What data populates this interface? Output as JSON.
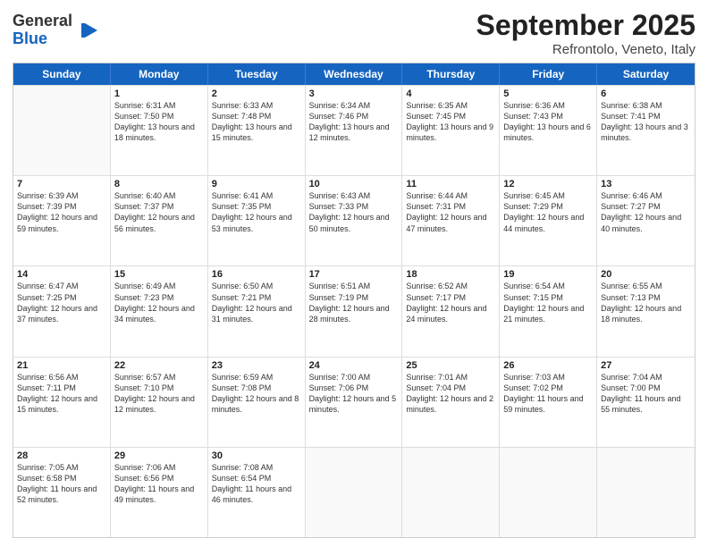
{
  "logo": {
    "general": "General",
    "blue": "Blue"
  },
  "title": {
    "month": "September 2025",
    "location": "Refrontolo, Veneto, Italy"
  },
  "header_days": [
    "Sunday",
    "Monday",
    "Tuesday",
    "Wednesday",
    "Thursday",
    "Friday",
    "Saturday"
  ],
  "weeks": [
    [
      {
        "date": "",
        "sunrise": "",
        "sunset": "",
        "daylight": ""
      },
      {
        "date": "1",
        "sunrise": "Sunrise: 6:31 AM",
        "sunset": "Sunset: 7:50 PM",
        "daylight": "Daylight: 13 hours and 18 minutes."
      },
      {
        "date": "2",
        "sunrise": "Sunrise: 6:33 AM",
        "sunset": "Sunset: 7:48 PM",
        "daylight": "Daylight: 13 hours and 15 minutes."
      },
      {
        "date": "3",
        "sunrise": "Sunrise: 6:34 AM",
        "sunset": "Sunset: 7:46 PM",
        "daylight": "Daylight: 13 hours and 12 minutes."
      },
      {
        "date": "4",
        "sunrise": "Sunrise: 6:35 AM",
        "sunset": "Sunset: 7:45 PM",
        "daylight": "Daylight: 13 hours and 9 minutes."
      },
      {
        "date": "5",
        "sunrise": "Sunrise: 6:36 AM",
        "sunset": "Sunset: 7:43 PM",
        "daylight": "Daylight: 13 hours and 6 minutes."
      },
      {
        "date": "6",
        "sunrise": "Sunrise: 6:38 AM",
        "sunset": "Sunset: 7:41 PM",
        "daylight": "Daylight: 13 hours and 3 minutes."
      }
    ],
    [
      {
        "date": "7",
        "sunrise": "Sunrise: 6:39 AM",
        "sunset": "Sunset: 7:39 PM",
        "daylight": "Daylight: 12 hours and 59 minutes."
      },
      {
        "date": "8",
        "sunrise": "Sunrise: 6:40 AM",
        "sunset": "Sunset: 7:37 PM",
        "daylight": "Daylight: 12 hours and 56 minutes."
      },
      {
        "date": "9",
        "sunrise": "Sunrise: 6:41 AM",
        "sunset": "Sunset: 7:35 PM",
        "daylight": "Daylight: 12 hours and 53 minutes."
      },
      {
        "date": "10",
        "sunrise": "Sunrise: 6:43 AM",
        "sunset": "Sunset: 7:33 PM",
        "daylight": "Daylight: 12 hours and 50 minutes."
      },
      {
        "date": "11",
        "sunrise": "Sunrise: 6:44 AM",
        "sunset": "Sunset: 7:31 PM",
        "daylight": "Daylight: 12 hours and 47 minutes."
      },
      {
        "date": "12",
        "sunrise": "Sunrise: 6:45 AM",
        "sunset": "Sunset: 7:29 PM",
        "daylight": "Daylight: 12 hours and 44 minutes."
      },
      {
        "date": "13",
        "sunrise": "Sunrise: 6:46 AM",
        "sunset": "Sunset: 7:27 PM",
        "daylight": "Daylight: 12 hours and 40 minutes."
      }
    ],
    [
      {
        "date": "14",
        "sunrise": "Sunrise: 6:47 AM",
        "sunset": "Sunset: 7:25 PM",
        "daylight": "Daylight: 12 hours and 37 minutes."
      },
      {
        "date": "15",
        "sunrise": "Sunrise: 6:49 AM",
        "sunset": "Sunset: 7:23 PM",
        "daylight": "Daylight: 12 hours and 34 minutes."
      },
      {
        "date": "16",
        "sunrise": "Sunrise: 6:50 AM",
        "sunset": "Sunset: 7:21 PM",
        "daylight": "Daylight: 12 hours and 31 minutes."
      },
      {
        "date": "17",
        "sunrise": "Sunrise: 6:51 AM",
        "sunset": "Sunset: 7:19 PM",
        "daylight": "Daylight: 12 hours and 28 minutes."
      },
      {
        "date": "18",
        "sunrise": "Sunrise: 6:52 AM",
        "sunset": "Sunset: 7:17 PM",
        "daylight": "Daylight: 12 hours and 24 minutes."
      },
      {
        "date": "19",
        "sunrise": "Sunrise: 6:54 AM",
        "sunset": "Sunset: 7:15 PM",
        "daylight": "Daylight: 12 hours and 21 minutes."
      },
      {
        "date": "20",
        "sunrise": "Sunrise: 6:55 AM",
        "sunset": "Sunset: 7:13 PM",
        "daylight": "Daylight: 12 hours and 18 minutes."
      }
    ],
    [
      {
        "date": "21",
        "sunrise": "Sunrise: 6:56 AM",
        "sunset": "Sunset: 7:11 PM",
        "daylight": "Daylight: 12 hours and 15 minutes."
      },
      {
        "date": "22",
        "sunrise": "Sunrise: 6:57 AM",
        "sunset": "Sunset: 7:10 PM",
        "daylight": "Daylight: 12 hours and 12 minutes."
      },
      {
        "date": "23",
        "sunrise": "Sunrise: 6:59 AM",
        "sunset": "Sunset: 7:08 PM",
        "daylight": "Daylight: 12 hours and 8 minutes."
      },
      {
        "date": "24",
        "sunrise": "Sunrise: 7:00 AM",
        "sunset": "Sunset: 7:06 PM",
        "daylight": "Daylight: 12 hours and 5 minutes."
      },
      {
        "date": "25",
        "sunrise": "Sunrise: 7:01 AM",
        "sunset": "Sunset: 7:04 PM",
        "daylight": "Daylight: 12 hours and 2 minutes."
      },
      {
        "date": "26",
        "sunrise": "Sunrise: 7:03 AM",
        "sunset": "Sunset: 7:02 PM",
        "daylight": "Daylight: 11 hours and 59 minutes."
      },
      {
        "date": "27",
        "sunrise": "Sunrise: 7:04 AM",
        "sunset": "Sunset: 7:00 PM",
        "daylight": "Daylight: 11 hours and 55 minutes."
      }
    ],
    [
      {
        "date": "28",
        "sunrise": "Sunrise: 7:05 AM",
        "sunset": "Sunset: 6:58 PM",
        "daylight": "Daylight: 11 hours and 52 minutes."
      },
      {
        "date": "29",
        "sunrise": "Sunrise: 7:06 AM",
        "sunset": "Sunset: 6:56 PM",
        "daylight": "Daylight: 11 hours and 49 minutes."
      },
      {
        "date": "30",
        "sunrise": "Sunrise: 7:08 AM",
        "sunset": "Sunset: 6:54 PM",
        "daylight": "Daylight: 11 hours and 46 minutes."
      },
      {
        "date": "",
        "sunrise": "",
        "sunset": "",
        "daylight": ""
      },
      {
        "date": "",
        "sunrise": "",
        "sunset": "",
        "daylight": ""
      },
      {
        "date": "",
        "sunrise": "",
        "sunset": "",
        "daylight": ""
      },
      {
        "date": "",
        "sunrise": "",
        "sunset": "",
        "daylight": ""
      }
    ]
  ]
}
